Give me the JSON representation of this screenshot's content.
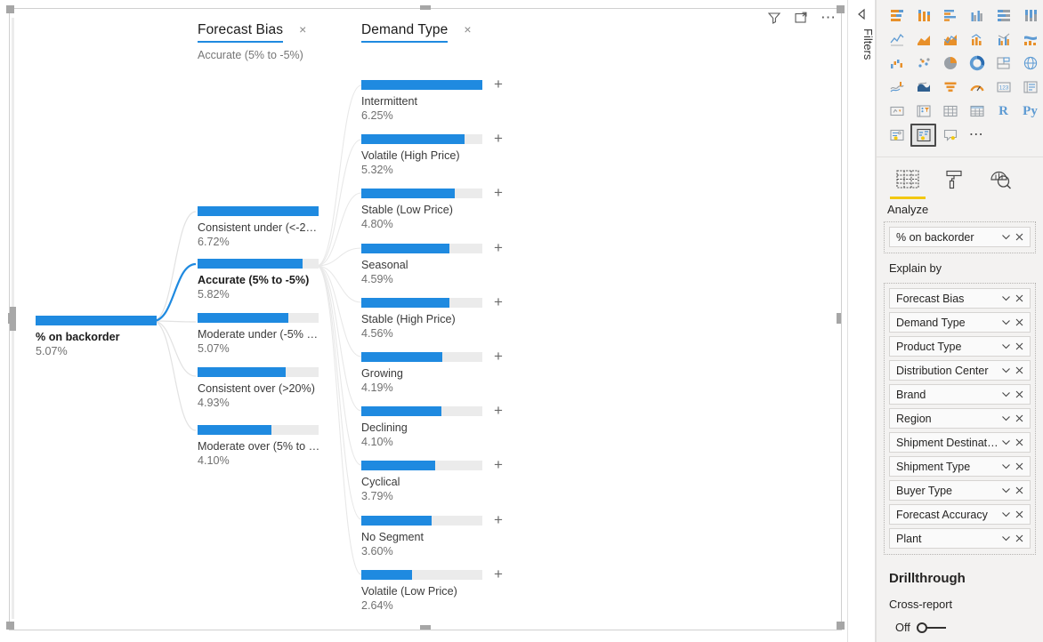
{
  "visual": {
    "actions": [
      {
        "name": "filter-icon",
        "label": "Filters"
      },
      {
        "name": "focus-mode-icon",
        "label": "Focus mode"
      },
      {
        "name": "more-options-icon",
        "label": "More options"
      }
    ]
  },
  "tree": {
    "root": {
      "label": "% on backorder",
      "value": "5.07%",
      "fill_pct": 100,
      "selected": true
    },
    "columns": [
      {
        "title": "Forecast Bias",
        "subtitle": "Accurate (5% to -5%)",
        "close": "×"
      },
      {
        "title": "Demand Type",
        "subtitle": "",
        "close": "×"
      }
    ],
    "level1": [
      {
        "label": "Consistent under (<-2…",
        "value": "6.72%",
        "fill_pct": 100,
        "selected": false
      },
      {
        "label": "Accurate (5% to -5%)",
        "value": "5.82%",
        "fill_pct": 87,
        "selected": true
      },
      {
        "label": "Moderate under (-5% …",
        "value": "5.07%",
        "fill_pct": 75,
        "selected": false
      },
      {
        "label": "Consistent over (>20%)",
        "value": "4.93%",
        "fill_pct": 73,
        "selected": false
      },
      {
        "label": "Moderate over (5% to …",
        "value": "4.10%",
        "fill_pct": 61,
        "selected": false
      }
    ],
    "level2": [
      {
        "label": "Intermittent",
        "value": "6.25%",
        "fill_pct": 100,
        "expand": "+"
      },
      {
        "label": "Volatile (High Price)",
        "value": "5.32%",
        "fill_pct": 85,
        "expand": "+"
      },
      {
        "label": "Stable (Low Price)",
        "value": "4.80%",
        "fill_pct": 77,
        "expand": "+"
      },
      {
        "label": "Seasonal",
        "value": "4.59%",
        "fill_pct": 73,
        "expand": "+"
      },
      {
        "label": "Stable (High Price)",
        "value": "4.56%",
        "fill_pct": 73,
        "expand": "+"
      },
      {
        "label": "Growing",
        "value": "4.19%",
        "fill_pct": 67,
        "expand": "+"
      },
      {
        "label": "Declining",
        "value": "4.10%",
        "fill_pct": 66,
        "expand": "+"
      },
      {
        "label": "Cyclical",
        "value": "3.79%",
        "fill_pct": 61,
        "expand": "+"
      },
      {
        "label": "No Segment",
        "value": "3.60%",
        "fill_pct": 58,
        "expand": "+"
      },
      {
        "label": "Volatile (Low Price)",
        "value": "2.64%",
        "fill_pct": 42,
        "expand": "+"
      }
    ]
  },
  "filters_rail": {
    "label": "Filters"
  },
  "right_pane": {
    "gallery_icons": [
      "stacked-bar-chart-icon",
      "stacked-column-chart-icon",
      "clustered-bar-chart-icon",
      "clustered-column-chart-icon",
      "hundred-percent-stacked-bar-chart-icon",
      "hundred-percent-stacked-column-chart-icon",
      "line-chart-icon",
      "area-chart-icon",
      "stacked-area-chart-icon",
      "line-stacked-column-chart-icon",
      "line-clustered-column-chart-icon",
      "ribbon-chart-icon",
      "waterfall-chart-icon",
      "scatter-chart-icon",
      "pie-chart-icon",
      "donut-chart-icon",
      "treemap-icon",
      "map-icon",
      "filled-map-icon",
      "shape-map-icon",
      "funnel-chart-icon",
      "gauge-chart-icon",
      "card-icon",
      "multi-row-card-icon",
      "kpi-icon",
      "slicer-icon",
      "table-icon",
      "matrix-icon",
      "r-script-visual-icon",
      "python-visual-icon",
      "key-influencers-icon",
      "decomposition-tree-icon",
      "qna-visual-icon",
      "more-visuals-icon"
    ],
    "selected_gallery_icon": "decomposition-tree-icon",
    "format_tabs": [
      {
        "name": "build-visual-tab",
        "icon": "fields-icon",
        "active": true
      },
      {
        "name": "format-visual-tab",
        "icon": "paint-roller-icon",
        "active": false
      },
      {
        "name": "analytics-tab",
        "icon": "analytics-magnifier-icon",
        "active": false
      }
    ],
    "analyze": {
      "label": "Analyze",
      "field": "% on backorder",
      "chevron": "∨",
      "remove": "×"
    },
    "explain_by": {
      "label": "Explain by",
      "fields": [
        "Forecast Bias",
        "Demand Type",
        "Product Type",
        "Distribution Center",
        "Brand",
        "Region",
        "Shipment Destination",
        "Shipment Type",
        "Buyer Type",
        "Forecast Accuracy",
        "Plant"
      ]
    },
    "drillthrough": {
      "title": "Drillthrough",
      "cross_report_label": "Cross-report",
      "toggle_state": "Off"
    }
  },
  "colors": {
    "accent_blue": "#1f8ae0",
    "track_gray": "#ebebeb",
    "pane_bg": "#f3f2f1",
    "tab_highlight": "#f2c811"
  }
}
